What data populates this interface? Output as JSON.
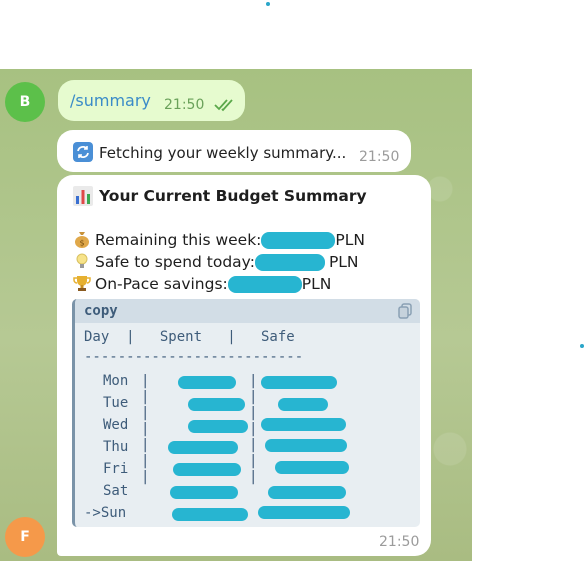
{
  "colors": {
    "accent": "#27b5d1",
    "outgoing_bubble": "#e6fbcf",
    "link": "#3a8bc8",
    "chat_bg": "#a9bf85"
  },
  "user_avatar": {
    "letter": "B",
    "color": "#5cc04a"
  },
  "bot_avatar": {
    "letter": "F",
    "color": "#f5994a"
  },
  "message_command": {
    "text": "/summary",
    "time": "21:50",
    "status_icon": "double-check-icon"
  },
  "message_fetching": {
    "icon": "refresh-icon",
    "text": "Fetching your weekly summary...",
    "time": "21:50"
  },
  "summary": {
    "title_icon": "bar-chart-icon",
    "title": "Your Current Budget Summary",
    "remaining_label": "Remaining this week:",
    "remaining_unit": "PLN",
    "safe_label": "Safe to spend today:",
    "safe_unit": "PLN",
    "onpace_label": "On-Pace savings:",
    "onpace_unit": "PLN",
    "time": "21:50",
    "code": {
      "lang": "copy",
      "copy_icon": "copy-icon",
      "header": "Day  |   Spent   |   Safe",
      "divider": "--------------------------",
      "days": [
        "Mon",
        "Tue",
        "Wed",
        "Thu",
        "Fri",
        "Sat",
        "->Sun"
      ]
    }
  }
}
